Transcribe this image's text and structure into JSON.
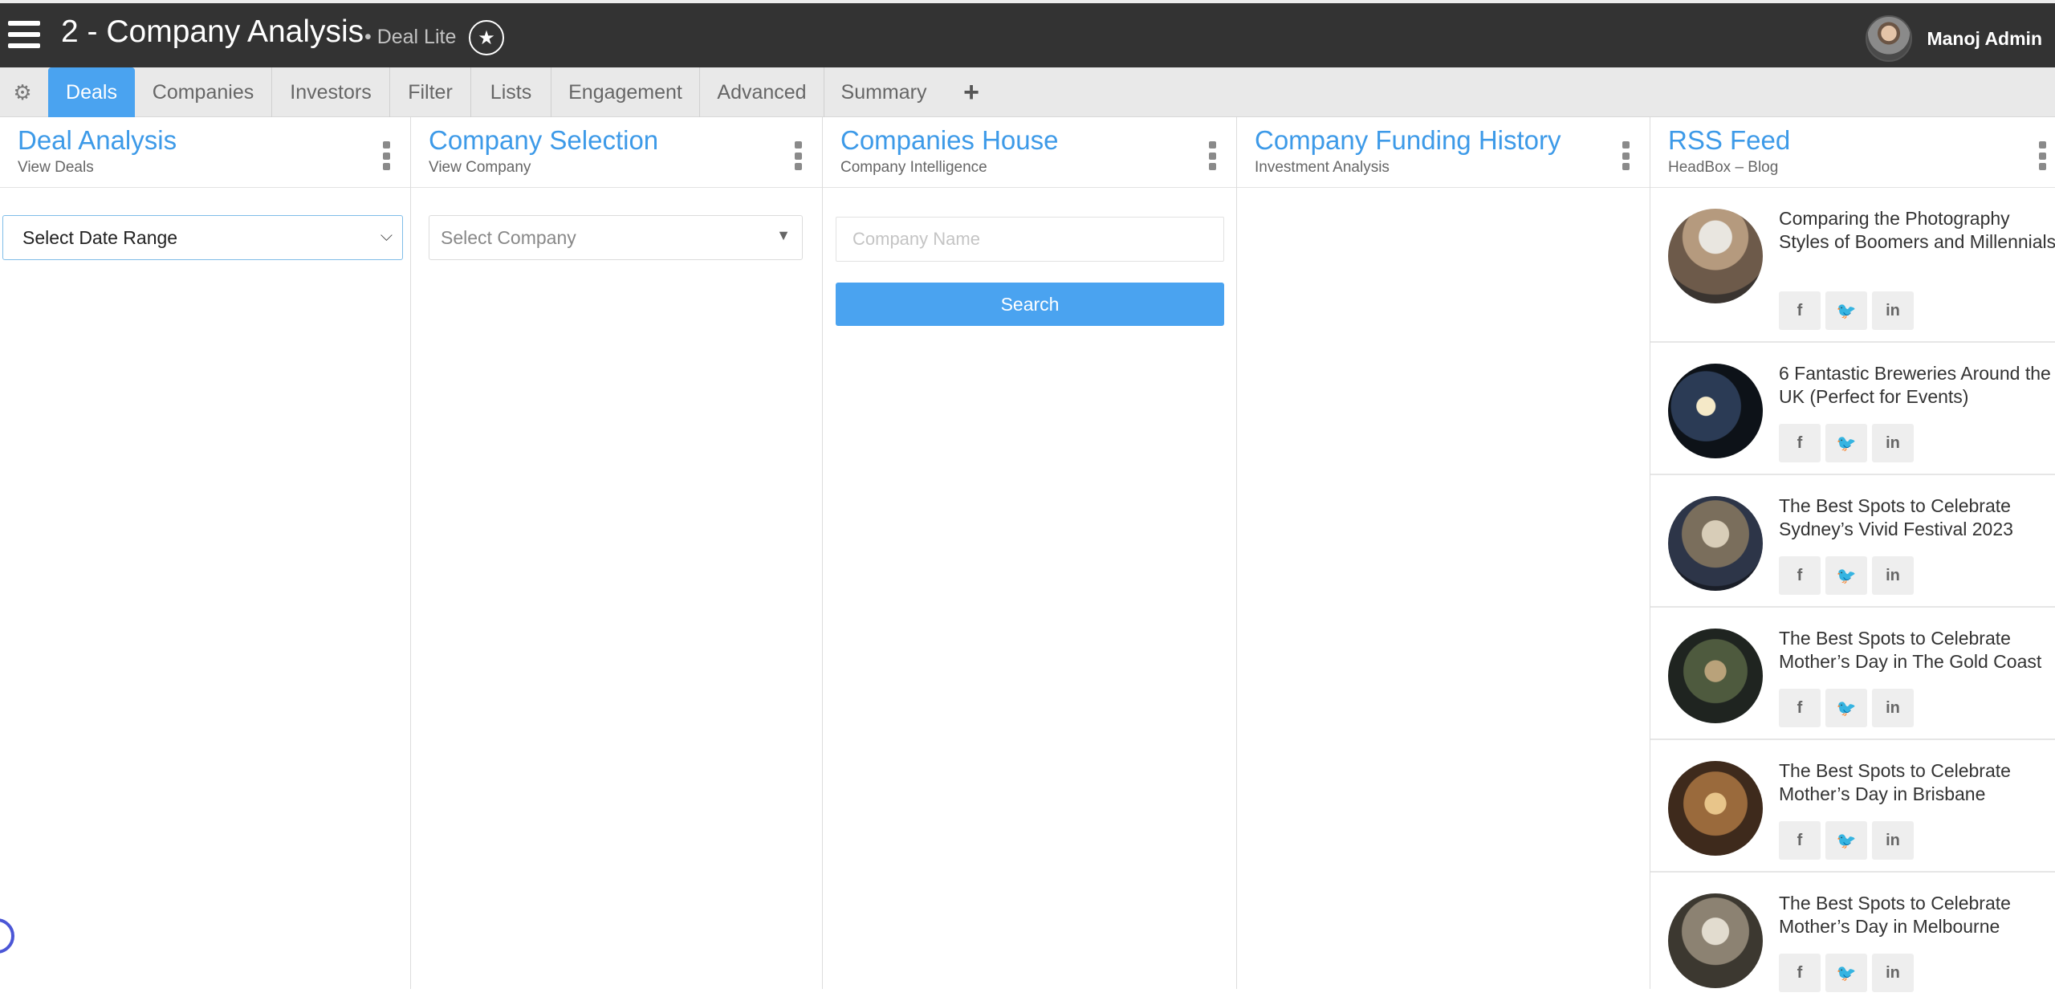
{
  "header": {
    "title": "2 - Company Analysis",
    "subtitle": "• Deal Lite",
    "user_name": "Manoj Admin"
  },
  "tabs": {
    "items": [
      {
        "label": "Deals",
        "active": true
      },
      {
        "label": "Companies"
      },
      {
        "label": "Investors"
      },
      {
        "label": "Filter"
      },
      {
        "label": "Lists"
      },
      {
        "label": "Engagement"
      },
      {
        "label": "Advanced"
      },
      {
        "label": "Summary"
      }
    ],
    "add_label": "+"
  },
  "panels": {
    "deal_analysis": {
      "title": "Deal Analysis",
      "subtitle": "View Deals",
      "date_range_value": "Select Date Range"
    },
    "company_selection": {
      "title": "Company Selection",
      "subtitle": "View Company",
      "select_placeholder": "Select Company"
    },
    "companies_house": {
      "title": "Companies House",
      "subtitle": "Company Intelligence",
      "input_placeholder": "Company Name",
      "search_label": "Search"
    },
    "funding_history": {
      "title": "Company Funding History",
      "subtitle": "Investment Analysis"
    },
    "rss": {
      "title": "RSS Feed",
      "subtitle": "HeadBox – Blog",
      "share_labels": {
        "facebook": "f",
        "twitter": "🐦",
        "linkedin": "in"
      },
      "items": [
        {
          "title": "Comparing the Photography Styles of Boomers and Millennials"
        },
        {
          "title": "6 Fantastic Breweries Around the UK (Perfect for Events)"
        },
        {
          "title": "The Best Spots to Celebrate Sydney’s Vivid Festival 2023"
        },
        {
          "title": "The Best Spots to Celebrate Mother’s Day in The Gold Coast"
        },
        {
          "title": "The Best Spots to Celebrate Mother’s Day in Brisbane"
        },
        {
          "title": "The Best Spots to Celebrate Mother’s Day in Melbourne"
        }
      ]
    }
  },
  "colors": {
    "accent": "#4aa3f0",
    "topbar": "#333333",
    "title_blue": "#3d9ae8"
  }
}
